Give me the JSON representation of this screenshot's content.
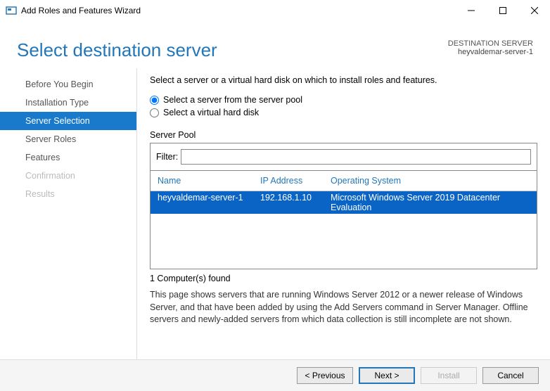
{
  "window": {
    "title": "Add Roles and Features Wizard"
  },
  "header": {
    "page_title": "Select destination server",
    "dest_heading": "DESTINATION SERVER",
    "dest_server": "heyvaldemar-server-1"
  },
  "sidebar": {
    "items": [
      {
        "label": "Before You Begin",
        "active": false,
        "disabled": false
      },
      {
        "label": "Installation Type",
        "active": false,
        "disabled": false
      },
      {
        "label": "Server Selection",
        "active": true,
        "disabled": false
      },
      {
        "label": "Server Roles",
        "active": false,
        "disabled": false
      },
      {
        "label": "Features",
        "active": false,
        "disabled": false
      },
      {
        "label": "Confirmation",
        "active": false,
        "disabled": true
      },
      {
        "label": "Results",
        "active": false,
        "disabled": true
      }
    ]
  },
  "main": {
    "instruction": "Select a server or a virtual hard disk on which to install roles and features.",
    "radios": {
      "pool": "Select a server from the server pool",
      "vhd": "Select a virtual hard disk",
      "selected": "pool"
    },
    "server_pool_label": "Server Pool",
    "filter_label": "Filter:",
    "filter_value": "",
    "columns": {
      "name": "Name",
      "ip": "IP Address",
      "os": "Operating System"
    },
    "rows": [
      {
        "name": "heyvaldemar-server-1",
        "ip": "192.168.1.10",
        "os": "Microsoft Windows Server 2019 Datacenter Evaluation",
        "selected": true
      }
    ],
    "count_text": "1 Computer(s) found",
    "help_text": "This page shows servers that are running Windows Server 2012 or a newer release of Windows Server, and that have been added by using the Add Servers command in Server Manager. Offline servers and newly-added servers from which data collection is still incomplete are not shown."
  },
  "buttons": {
    "previous": "< Previous",
    "next": "Next >",
    "install": "Install",
    "cancel": "Cancel"
  }
}
